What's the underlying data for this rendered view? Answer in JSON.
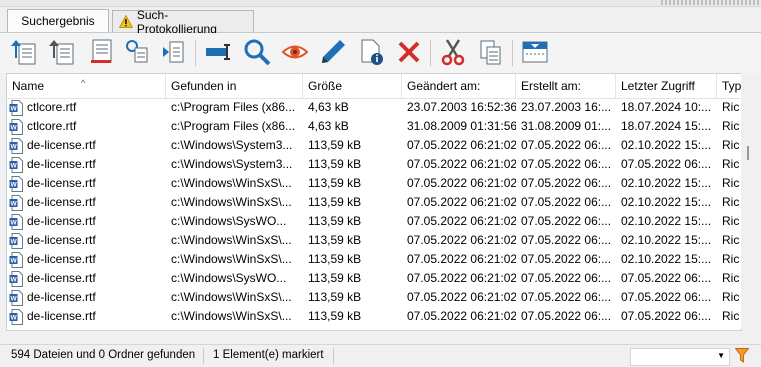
{
  "tabs": [
    {
      "label": "Suchergebnis",
      "active": true
    },
    {
      "label": "Such-Protokollierung",
      "active": false,
      "icon": "warning-icon"
    }
  ],
  "toolbar": {
    "buttons": [
      "export-up-icon",
      "export-list-icon",
      "list-icon",
      "copy-path-icon",
      "move-icon",
      "rename-icon",
      "search-icon",
      "view-icon",
      "edit-icon",
      "properties-icon",
      "delete-icon",
      "cut-icon",
      "copy-icon",
      "layout-icon"
    ]
  },
  "columns": [
    "Name",
    "Gefunden in",
    "Größe",
    "Geändert am:",
    "Erstellt am:",
    "Letzter Zugriff",
    "Typ"
  ],
  "rows": [
    {
      "name": "ctlcore.rtf",
      "path": "c:\\Program Files (x86...",
      "size": "4,63 kB",
      "modified": "23.07.2003 16:52:36",
      "created": "23.07.2003 16:...",
      "accessed": "18.07.2024 10:...",
      "type": "Ric"
    },
    {
      "name": "ctlcore.rtf",
      "path": "c:\\Program Files (x86...",
      "size": "4,63 kB",
      "modified": "31.08.2009 01:31:56",
      "created": "31.08.2009 01:...",
      "accessed": "18.07.2024 15:...",
      "type": "Ric"
    },
    {
      "name": "de-license.rtf",
      "path": "c:\\Windows\\System3...",
      "size": "113,59 kB",
      "modified": "07.05.2022 06:21:02",
      "created": "07.05.2022 06:...",
      "accessed": "02.10.2022 15:...",
      "type": "Ric"
    },
    {
      "name": "de-license.rtf",
      "path": "c:\\Windows\\System3...",
      "size": "113,59 kB",
      "modified": "07.05.2022 06:21:02",
      "created": "07.05.2022 06:...",
      "accessed": "07.05.2022 06:...",
      "type": "Ric"
    },
    {
      "name": "de-license.rtf",
      "path": "c:\\Windows\\WinSxS\\...",
      "size": "113,59 kB",
      "modified": "07.05.2022 06:21:02",
      "created": "07.05.2022 06:...",
      "accessed": "02.10.2022 15:...",
      "type": "Ric"
    },
    {
      "name": "de-license.rtf",
      "path": "c:\\Windows\\WinSxS\\...",
      "size": "113,59 kB",
      "modified": "07.05.2022 06:21:02",
      "created": "07.05.2022 06:...",
      "accessed": "02.10.2022 15:...",
      "type": "Ric"
    },
    {
      "name": "de-license.rtf",
      "path": "c:\\Windows\\SysWO...",
      "size": "113,59 kB",
      "modified": "07.05.2022 06:21:02",
      "created": "07.05.2022 06:...",
      "accessed": "02.10.2022 15:...",
      "type": "Ric"
    },
    {
      "name": "de-license.rtf",
      "path": "c:\\Windows\\WinSxS\\...",
      "size": "113,59 kB",
      "modified": "07.05.2022 06:21:02",
      "created": "07.05.2022 06:...",
      "accessed": "02.10.2022 15:...",
      "type": "Ric"
    },
    {
      "name": "de-license.rtf",
      "path": "c:\\Windows\\WinSxS\\...",
      "size": "113,59 kB",
      "modified": "07.05.2022 06:21:02",
      "created": "07.05.2022 06:...",
      "accessed": "02.10.2022 15:...",
      "type": "Ric"
    },
    {
      "name": "de-license.rtf",
      "path": "c:\\Windows\\SysWO...",
      "size": "113,59 kB",
      "modified": "07.05.2022 06:21:02",
      "created": "07.05.2022 06:...",
      "accessed": "07.05.2022 06:...",
      "type": "Ric"
    },
    {
      "name": "de-license.rtf",
      "path": "c:\\Windows\\WinSxS\\...",
      "size": "113,59 kB",
      "modified": "07.05.2022 06:21:02",
      "created": "07.05.2022 06:...",
      "accessed": "07.05.2022 06:...",
      "type": "Ric"
    },
    {
      "name": "de-license.rtf",
      "path": "c:\\Windows\\WinSxS\\...",
      "size": "113,59 kB",
      "modified": "07.05.2022 06:21:02",
      "created": "07.05.2022 06:...",
      "accessed": "07.05.2022 06:...",
      "type": "Ric"
    }
  ],
  "status": {
    "found": "594 Dateien und 0 Ordner gefunden",
    "selected": "1 Element(e) markiert",
    "filter_value": ""
  },
  "colors": {
    "accent": "#1e6fb5",
    "delete": "#d62b2b",
    "eye": "#e0542a",
    "tab_bg": "#fbfbfb"
  }
}
